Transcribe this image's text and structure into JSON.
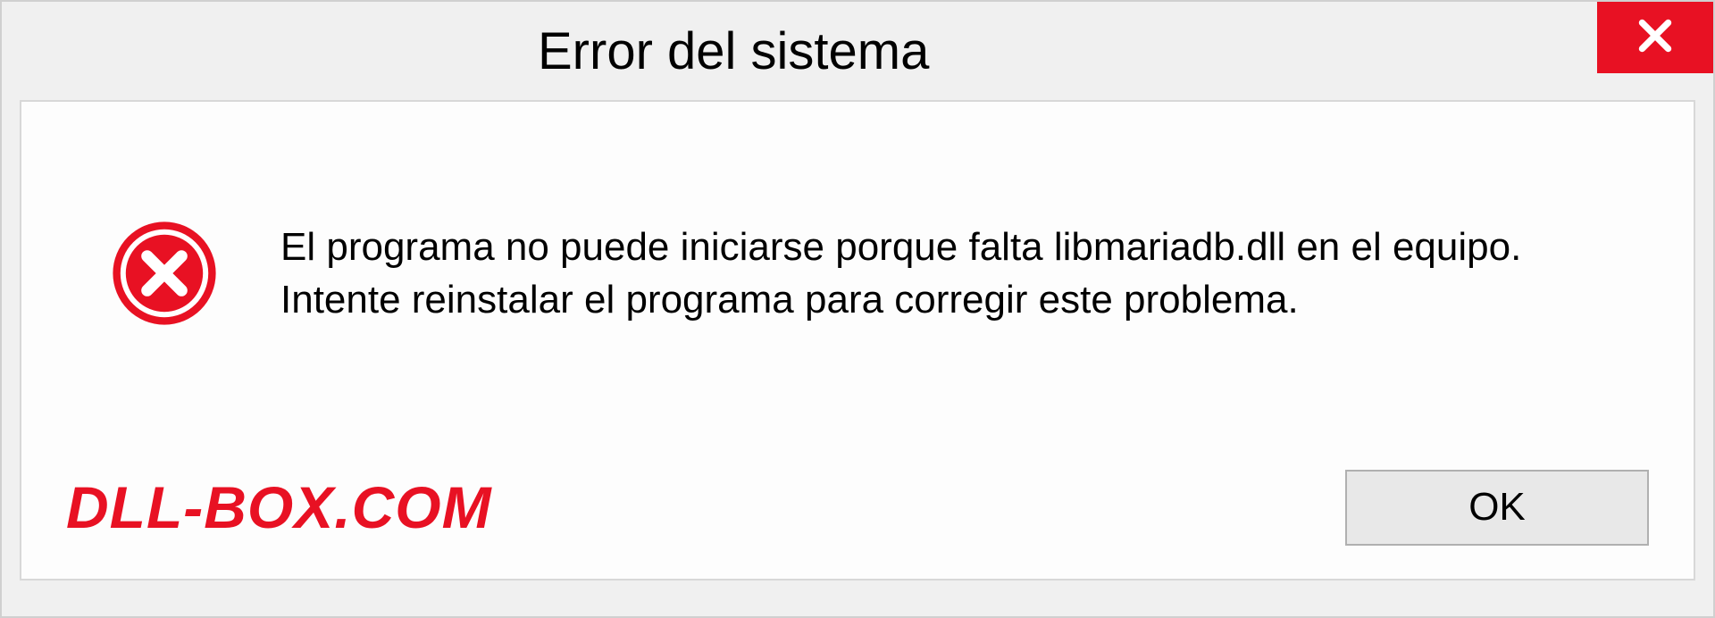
{
  "titlebar": {
    "title": "Error del sistema"
  },
  "message": {
    "text": "El programa no puede iniciarse porque falta libmariadb.dll en el equipo. Intente reinstalar el programa para corregir este problema."
  },
  "watermark": {
    "text": "DLL-BOX.COM"
  },
  "buttons": {
    "ok_label": "OK"
  }
}
